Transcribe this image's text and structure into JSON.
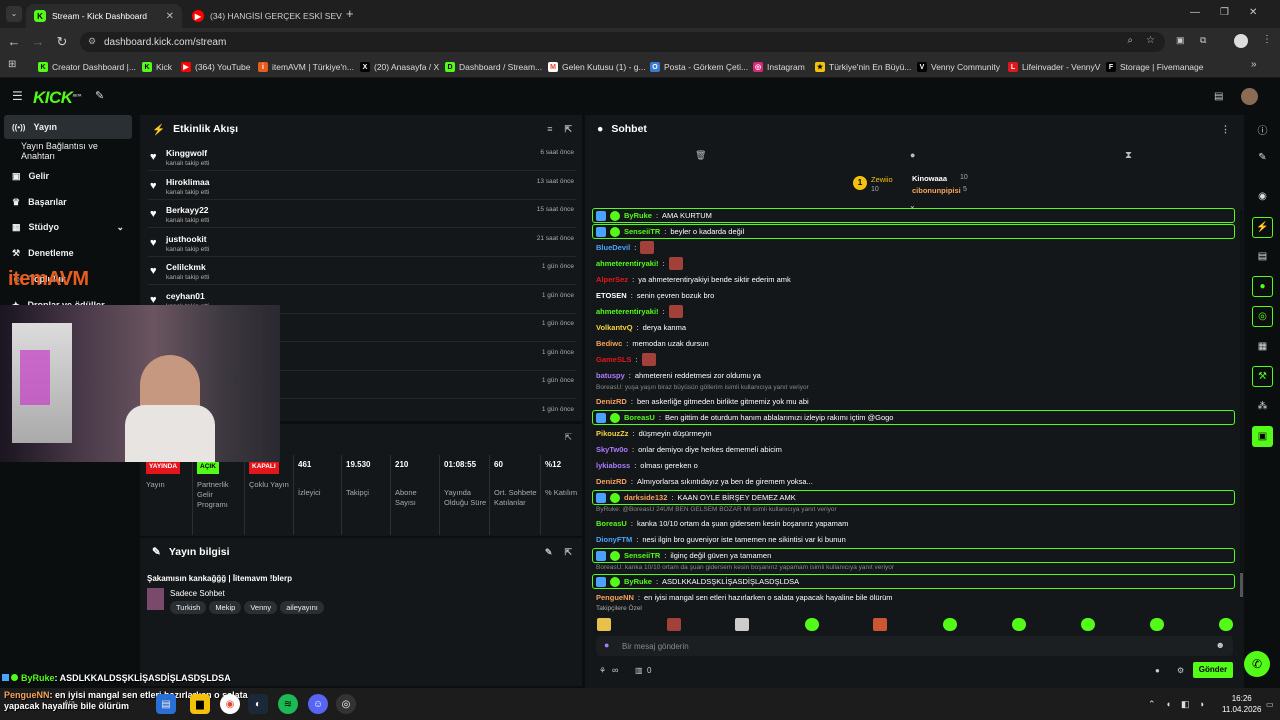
{
  "browser": {
    "tabs": [
      {
        "title": "Stream - Kick Dashboard",
        "favicon": "K",
        "color": "#53fc18",
        "active": true
      },
      {
        "title": "(34) HANGİSİ GERÇEK ESKİ SEV...",
        "favicon": "▶",
        "color": "#ff0000",
        "active": false
      }
    ],
    "new_tab": "+",
    "url": "dashboard.kick.com/stream",
    "bookmarks": [
      {
        "label": "Creator Dashboard |...",
        "color": "#53fc18",
        "icon": "K"
      },
      {
        "label": "Kick",
        "color": "#53fc18",
        "icon": "K"
      },
      {
        "label": "(364) YouTube",
        "color": "#ff0000",
        "icon": "▶"
      },
      {
        "label": "itemAVM | Türkiye'n...",
        "color": "#e85d1f",
        "icon": "i"
      },
      {
        "label": "(20) Anasayfa / X",
        "color": "#ffffff",
        "icon": "X"
      },
      {
        "label": "Dashboard / Stream...",
        "color": "#53fc18",
        "icon": "D"
      },
      {
        "label": "Gelen Kutusu (1) - g...",
        "color": "#ea4335",
        "icon": "M"
      },
      {
        "label": "Posta - Görkem Çeti...",
        "color": "#3a7bd5",
        "icon": "O"
      },
      {
        "label": "Instagram",
        "color": "#d62976",
        "icon": "◎"
      },
      {
        "label": "Türkiye'nin En Büyü...",
        "color": "#f4c20d",
        "icon": "★"
      },
      {
        "label": "Venny Community",
        "color": "#ffffff",
        "icon": "V"
      },
      {
        "label": "Lifeinvader - VennyV",
        "color": "#e3161c",
        "icon": "L"
      },
      {
        "label": "Storage | Fivemanage",
        "color": "#ffffff",
        "icon": "F"
      }
    ]
  },
  "brand": {
    "logo": "KICK",
    "beta": "BETA",
    "accent": "#53fc18"
  },
  "sidebar": {
    "items": [
      {
        "label": "Yayın",
        "icon": "broadcast-icon"
      },
      {
        "label": "Yayın Bağlantısı ve Anahtarı",
        "icon": ""
      },
      {
        "label": "Gelir",
        "icon": "wallet-icon"
      },
      {
        "label": "Başarılar",
        "icon": "trophy-icon"
      },
      {
        "label": "Stüdyo",
        "icon": "studio-icon"
      },
      {
        "label": "Denetleme",
        "icon": "shield-icon"
      },
      {
        "label": "Topluluk",
        "icon": "users-icon"
      },
      {
        "label": "Droplar ve ödüller",
        "icon": "gift-icon"
      }
    ],
    "overlay_logo": "itemAVM"
  },
  "activity": {
    "title": "Etkinlik Akışı",
    "items": [
      {
        "name": "Kinggwolf",
        "action": "kanalı takip etti",
        "time": "6 saat önce"
      },
      {
        "name": "Hiroklimaa",
        "action": "kanalı takip etti",
        "time": "13 saat önce"
      },
      {
        "name": "Berkayy22",
        "action": "kanalı takip etti",
        "time": "15 saat önce"
      },
      {
        "name": "justhookit",
        "action": "kanalı takip etti",
        "time": "21 saat önce"
      },
      {
        "name": "Celilckmk",
        "action": "kanalı takip etti",
        "time": "1 gün önce"
      },
      {
        "name": "ceyhan01",
        "action": "kanalı takip etti",
        "time": "1 gün önce"
      },
      {
        "name": "",
        "action": "",
        "time": "1 gün önce"
      },
      {
        "name": "",
        "action": "",
        "time": "1 gün önce"
      },
      {
        "name": "",
        "action": "",
        "time": "1 gün önce"
      },
      {
        "name": "",
        "action": "",
        "time": "1 gün önce"
      }
    ]
  },
  "stats": [
    {
      "value": "YAYINDA",
      "label": "Yayın",
      "style": "red"
    },
    {
      "value": "AÇIK",
      "label": "Partnerlik Gelir Programı",
      "style": "green"
    },
    {
      "value": "KAPALI",
      "label": "Çoklu Yayın",
      "style": "red"
    },
    {
      "value": "461",
      "label": "İzleyici",
      "style": "plain"
    },
    {
      "value": "19.530",
      "label": "Takipçi",
      "style": "plain"
    },
    {
      "value": "210",
      "label": "Abone Sayısı",
      "style": "plain"
    },
    {
      "value": "01:08:55",
      "label": "Yayında Olduğu Süre",
      "style": "plain"
    },
    {
      "value": "60",
      "label": "Ort. Sohbete Katılanlar",
      "style": "plain"
    },
    {
      "value": "%12",
      "label": "% Katılım",
      "style": "plain"
    }
  ],
  "stream_info": {
    "title": "Yayın bilgisi",
    "stream_title": "Şakamısın kankağğğ | İitemavm !blerp",
    "category": "Sadece Sohbet",
    "tags": [
      "Turkish",
      "Mekip",
      "Venny",
      "aileyayını"
    ]
  },
  "chat": {
    "title": "Sohbet",
    "top_gifters": [
      {
        "name": "Zewiio",
        "count": "10"
      },
      {
        "name": "Kinowaaa",
        "count": "10"
      },
      {
        "name": "cibonunpipisi",
        "count": "5"
      }
    ],
    "messages": [
      {
        "user": "ByRuke",
        "color": "#53fc18",
        "text": "AMA KURTUM",
        "highlight": true,
        "emote": false
      },
      {
        "user": "SenseiiTR",
        "color": "#53fc18",
        "text": "beyler o kadarda değil",
        "highlight": true,
        "emote": false
      },
      {
        "user": "BlueDevil",
        "color": "#4aa3ff",
        "text": "",
        "highlight": false,
        "emote": true
      },
      {
        "user": "ahmeterentiryaki!",
        "color": "#53fc18",
        "text": "",
        "highlight": false,
        "emote": true
      },
      {
        "user": "AlperSez",
        "color": "#e3161c",
        "text": "ya ahmeterentiryakiyi bende siktir ederim amk",
        "highlight": false,
        "emote": false
      },
      {
        "user": "ETOSEN",
        "color": "#ffffff",
        "text": "senin çevren bozuk bro",
        "highlight": false,
        "emote": false
      },
      {
        "user": "ahmeterentiryaki!",
        "color": "#53fc18",
        "text": "",
        "highlight": false,
        "emote": true
      },
      {
        "user": "VolkantvQ",
        "color": "#f4d33d",
        "text": "derya kanma",
        "highlight": false,
        "emote": false
      },
      {
        "user": "Bediwc",
        "color": "#f7a35c",
        "text": "memodan uzak dursun",
        "highlight": false,
        "emote": false
      },
      {
        "user": "GameSLS",
        "color": "#e3161c",
        "text": "",
        "highlight": false,
        "emote": true
      },
      {
        "user": "batuspy",
        "color": "#a97cff",
        "text": "ahmetereni reddetmesi zor oldumu ya",
        "highlight": false,
        "emote": false
      },
      {
        "user": "DenizRD",
        "color": "#f7a35c",
        "text": "ben askerliğe gitmeden birlikte gitmemiz yok mu abi",
        "highlight": false,
        "emote": false,
        "reply": "BoreasU: yuşa yaşın biraz büyüsün göllerim isimli kullanıcıya yanıt veriyor"
      },
      {
        "user": "BoreasU",
        "color": "#53fc18",
        "text": "Ben gittim de oturdum hanım ablalarımızı izleyip rakımı içtim @Gogo",
        "highlight": true,
        "emote": false
      },
      {
        "user": "PikouzZz",
        "color": "#f4d33d",
        "text": "düşmeyin düşürmeyin",
        "highlight": false,
        "emote": false
      },
      {
        "user": "SkyTw0o",
        "color": "#a97cff",
        "text": "onlar demiyoı diye herkes dememeli abicim",
        "highlight": false,
        "emote": false
      },
      {
        "user": "lykiaboss",
        "color": "#a97cff",
        "text": "olması gereken o",
        "highlight": false,
        "emote": false
      },
      {
        "user": "DenizRD",
        "color": "#f7a35c",
        "text": "Almıyorlarsa sıkıntıdayız ya ben de giremem yoksa...",
        "highlight": false,
        "emote": false
      },
      {
        "user": "darkside132",
        "color": "#f7a35c",
        "text": "KAAN OYLE BİRŞEY DEMEZ AMK",
        "highlight": true,
        "emote": false
      },
      {
        "user": "BoreasU",
        "color": "#53fc18",
        "text": "kanka 10/10 ortam da şuan gidersem kesin boşanırız yapamam",
        "highlight": false,
        "emote": false,
        "reply": "ByRuke: @BoreasU 24ÜM BEN GELSEM BOZAR Mİ isimli kullanıcıya yanıt veriyor"
      },
      {
        "user": "DionyFTM",
        "color": "#4aa3ff",
        "text": "nesi ilgin bro guveniyor iste tamemen ne sikintisi var ki bunun",
        "highlight": false,
        "emote": false
      },
      {
        "user": "SenseiiTR",
        "color": "#53fc18",
        "text": "ilginç değil güven ya tamamen",
        "highlight": true,
        "emote": false
      },
      {
        "user": "ByRuke",
        "color": "#53fc18",
        "text": "ASDLKKALDSŞKLİŞASDİŞLASDŞLDSA",
        "highlight": true,
        "emote": false,
        "reply": "BoreasU: kanka 10/10 ortam da şuan gidersem kesin boşanırız yapamam isimli kullanıcıya yanıt veriyor"
      },
      {
        "user": "PengueNN",
        "color": "#f7a35c",
        "text": "en iyisi mangal sen etleri hazırlarken o salata yapacak hayaline bile ölürüm",
        "highlight": false,
        "emote": false
      }
    ],
    "follower_only": "Takipçilere Özel",
    "input_placeholder": "Bir mesaj gönderin",
    "send_label": "Gönder",
    "infinity_count": "∞",
    "trash_count": "0"
  },
  "overlay": {
    "line1_user": "ByRuke",
    "line1_text": ": ASDLKKALDSŞKLİŞASDİŞLASDŞLDSA",
    "line2_user": "PengueNN",
    "line2_text": ": en iyisi mangal sen etleri hazırlarken o salata yapacak hayaline bile ölürüm",
    "search_label": "Ara"
  },
  "taskbar": {
    "time": "16:26",
    "date": "11.04.2026"
  }
}
